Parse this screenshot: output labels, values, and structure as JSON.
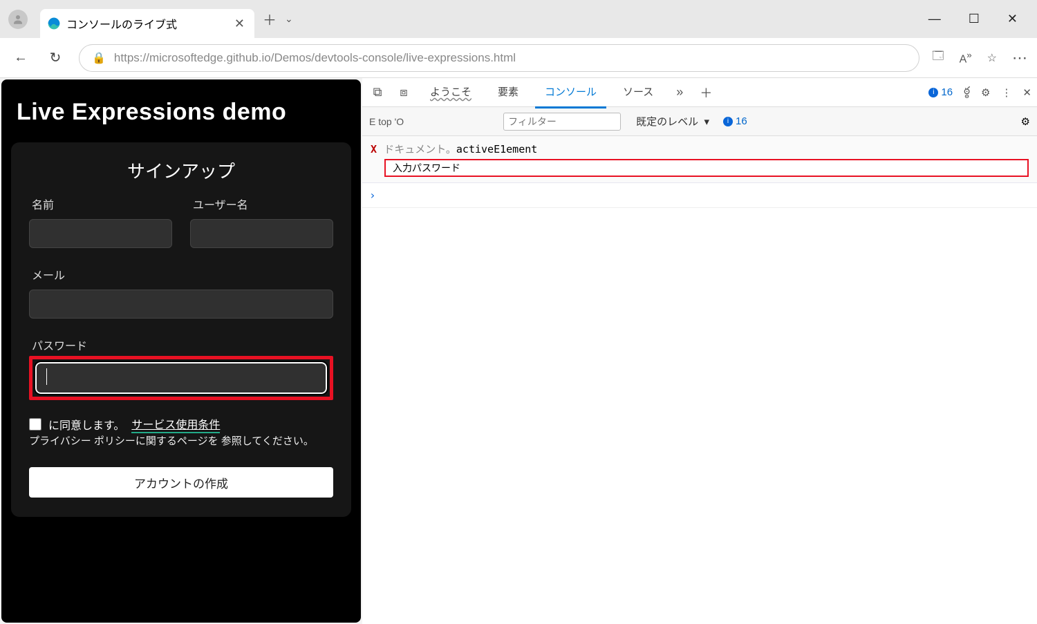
{
  "browser": {
    "tab_title": "コンソールのライブ式",
    "url": "https://microsoftedge.github.io/Demos/devtools-console/live-expressions.html"
  },
  "page": {
    "heading": "Live Expressions demo",
    "signup_title": "サインアップ",
    "name_label": "名前",
    "username_label": "ユーザー名",
    "email_label": "メール",
    "password_label": "パスワード",
    "agree_text": "に同意します。",
    "tos_text": "サービス使用条件",
    "privacy_text": "プライバシー ポリシーに関するページを 参照してください。",
    "create_btn": "アカウントの作成"
  },
  "devtools": {
    "tabs": {
      "welcome": "ようこそ",
      "elements": "要素",
      "console": "コンソール",
      "sources": "ソース"
    },
    "right_count": "16",
    "toolbar": {
      "context": "E top 'O",
      "filter_placeholder": "フィルター",
      "levels": "既定のレベル",
      "issues": "16"
    },
    "live_expr": {
      "prefix": "ドキュメント。",
      "active": "activeE1ement",
      "result": "入力パスワード"
    },
    "prompt": "›"
  }
}
